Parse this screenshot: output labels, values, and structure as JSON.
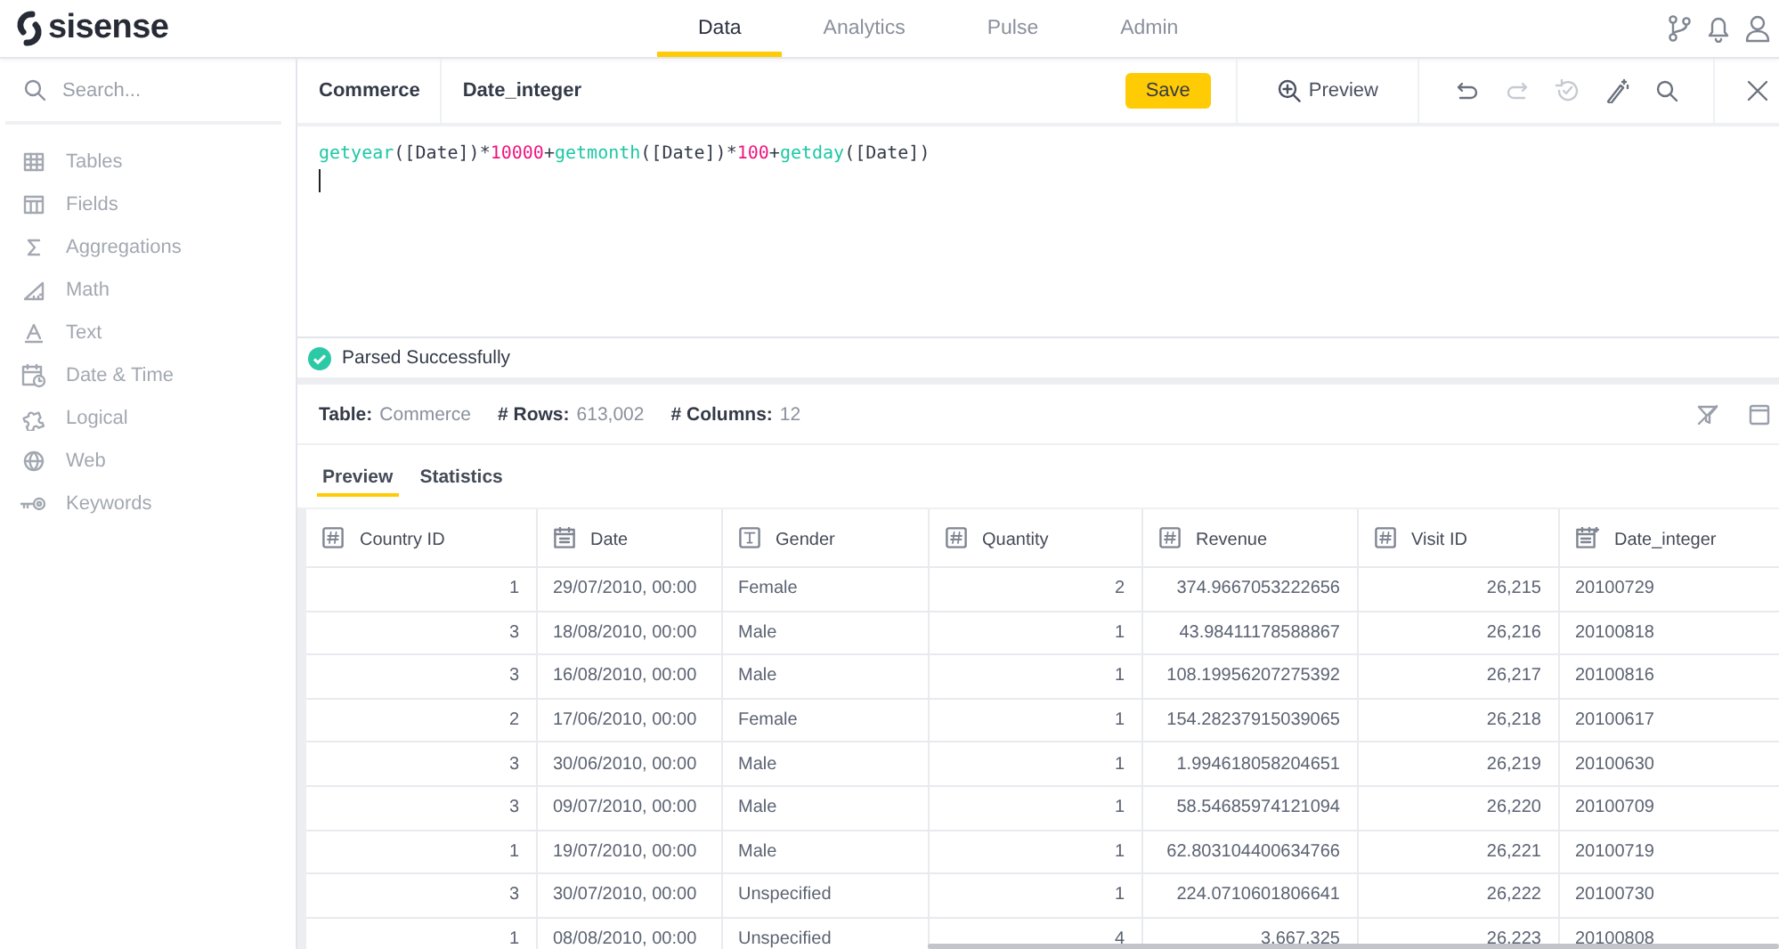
{
  "app": {
    "logo": "sisense"
  },
  "nav_tabs": [
    {
      "label": "Data",
      "selected": true
    },
    {
      "label": "Analytics",
      "selected": false
    },
    {
      "label": "Pulse",
      "selected": false
    },
    {
      "label": "Admin",
      "selected": false
    }
  ],
  "header_icons": [
    {
      "kind": "branch"
    },
    {
      "kind": "bell"
    },
    {
      "kind": "user"
    }
  ],
  "sidebar": {
    "search": {
      "placeholder": "Search..."
    },
    "items": [
      {
        "label": "Tables",
        "kind": "tables"
      },
      {
        "label": "Fields",
        "kind": "fields"
      },
      {
        "label": "Aggregations",
        "kind": "sigma"
      },
      {
        "label": "Math",
        "kind": "math"
      },
      {
        "label": "Text",
        "kind": "text"
      },
      {
        "label": "Date & Time",
        "kind": "datetime"
      },
      {
        "label": "Logical",
        "kind": "logical"
      },
      {
        "label": "Web",
        "kind": "web"
      },
      {
        "label": "Keywords",
        "kind": "keywords"
      }
    ]
  },
  "editor": {
    "breadcrumb": [
      "Commerce",
      "Date_integer"
    ],
    "save_label": "Save",
    "preview_label": "Preview",
    "tools": [
      {
        "kind": "undo",
        "disabled": false
      },
      {
        "kind": "redo",
        "disabled": true
      },
      {
        "kind": "restore",
        "disabled": true
      },
      {
        "kind": "wand",
        "disabled": false
      },
      {
        "kind": "search",
        "disabled": false
      }
    ],
    "formula": [
      {
        "kind": "func",
        "text": "getyear"
      },
      {
        "kind": "plain",
        "text": "([Date])*"
      },
      {
        "kind": "number",
        "text": "10000"
      },
      {
        "kind": "plain",
        "text": "+"
      },
      {
        "kind": "func",
        "text": "getmonth"
      },
      {
        "kind": "plain",
        "text": "([Date])*"
      },
      {
        "kind": "number",
        "text": "100"
      },
      {
        "kind": "plain",
        "text": "+"
      },
      {
        "kind": "func",
        "text": "getday"
      },
      {
        "kind": "plain",
        "text": "([Date])"
      }
    ],
    "status": "Parsed Successfully"
  },
  "table_info": [
    {
      "label": "Table:",
      "value": "Commerce"
    },
    {
      "label": "# Rows:",
      "value": "613,002"
    },
    {
      "label": "# Columns:",
      "value": "12"
    }
  ],
  "sub_tabs": [
    {
      "label": "Preview",
      "selected": true
    },
    {
      "label": "Statistics",
      "selected": false
    }
  ],
  "table": {
    "columns": [
      {
        "name": "Country ID",
        "kind": "number"
      },
      {
        "name": "Date",
        "kind": "date"
      },
      {
        "name": "Gender",
        "kind": "text"
      },
      {
        "name": "Quantity",
        "kind": "number"
      },
      {
        "name": "Revenue",
        "kind": "number"
      },
      {
        "name": "Visit ID",
        "kind": "number"
      },
      {
        "name": "Date_integer",
        "kind": "custom"
      }
    ],
    "rows": [
      [
        "1",
        "29/07/2010, 00:00",
        "Female",
        "2",
        "374.9667053222656",
        "26,215",
        "20100729"
      ],
      [
        "3",
        "18/08/2010, 00:00",
        "Male",
        "1",
        "43.98411178588867",
        "26,216",
        "20100818"
      ],
      [
        "3",
        "16/08/2010, 00:00",
        "Male",
        "1",
        "108.19956207275392",
        "26,217",
        "20100816"
      ],
      [
        "2",
        "17/06/2010, 00:00",
        "Female",
        "1",
        "154.28237915039065",
        "26,218",
        "20100617"
      ],
      [
        "3",
        "30/06/2010, 00:00",
        "Male",
        "1",
        "1.994618058204651",
        "26,219",
        "20100630"
      ],
      [
        "3",
        "09/07/2010, 00:00",
        "Male",
        "1",
        "58.54685974121094",
        "26,220",
        "20100709"
      ],
      [
        "1",
        "19/07/2010, 00:00",
        "Male",
        "1",
        "62.803104400634766",
        "26,221",
        "20100719"
      ],
      [
        "3",
        "30/07/2010, 00:00",
        "Unspecified",
        "1",
        "224.0710601806641",
        "26,222",
        "20100730"
      ],
      [
        "1",
        "08/08/2010, 00:00",
        "Unspecified",
        "4",
        "3,667.325",
        "26,223",
        "20100808"
      ]
    ]
  }
}
